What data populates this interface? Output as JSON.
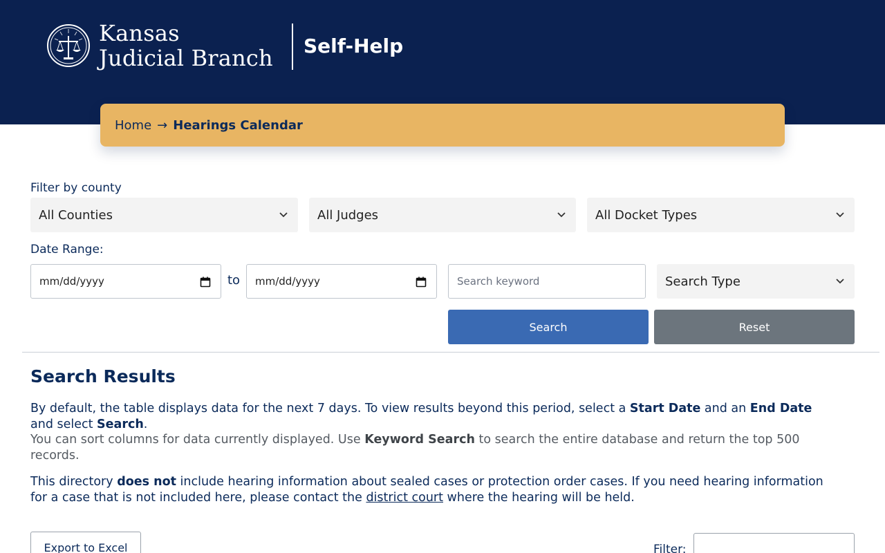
{
  "header": {
    "logo_line1": "Kansas",
    "logo_line2": "Judicial Branch",
    "section_title": "Self-Help",
    "background_color": "#0b2150"
  },
  "breadcrumb": {
    "home": "Home",
    "separator": "→",
    "current": "Hearings Calendar",
    "background_color": "#e8b563"
  },
  "filters": {
    "county_label": "Filter by county",
    "county_select": "All Counties",
    "judge_select": "All Judges",
    "docket_select": "All Docket Types",
    "date_range_label": "Date Range:",
    "start_date_placeholder": "mm/dd/yyyy",
    "to_label": "to",
    "end_date_placeholder": "mm/dd/yyyy",
    "keyword_placeholder": "Search keyword",
    "search_type_select": "Search Type",
    "search_button": "Search",
    "reset_button": "Reset",
    "search_button_color": "#3a6ab3",
    "reset_button_color": "#6c757d"
  },
  "results": {
    "title": "Search Results",
    "p1_a": "By default, the table displays data for the next 7 days. To view results beyond this period, select a ",
    "p1_b": "Start Date",
    "p1_c": " and an ",
    "p1_d": "End Date",
    "p1_e": " and select ",
    "p1_f": "Search",
    "p1_g": ".",
    "p2_a": "You can sort columns for data currently displayed. Use ",
    "p2_b": "Keyword Search",
    "p2_c": " to search the entire database and return the top 500 records.",
    "p3_a": "This directory ",
    "p3_b": "does not",
    "p3_c": " include hearing information about sealed cases or protection order cases. If you need hearing information for a case that is not included here, please contact the ",
    "p3_link": "district court",
    "p3_d": " where the hearing will be held."
  },
  "table_controls": {
    "export_button": "Export to Excel",
    "filter_label": "Filter:",
    "filter_value": ""
  },
  "icons": {
    "seal": "scales-of-justice-seal-icon",
    "select_chevron": "chevron-down-icon",
    "date_picker": "calendar-icon"
  }
}
